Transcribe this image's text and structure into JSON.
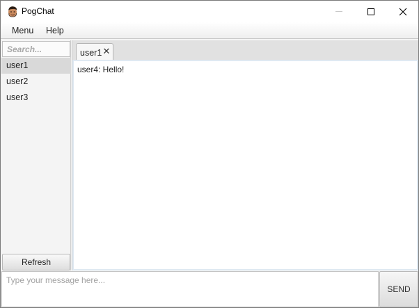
{
  "window": {
    "title": "PogChat",
    "app_icon": "avatar-face-icon",
    "controls": [
      "minimize-icon",
      "maximize-icon",
      "close-icon"
    ]
  },
  "menubar": {
    "items": [
      {
        "label": "Menu"
      },
      {
        "label": "Help"
      }
    ]
  },
  "sidebar": {
    "search_placeholder": "Search...",
    "users": [
      {
        "label": "user1",
        "selected": true
      },
      {
        "label": "user2",
        "selected": false
      },
      {
        "label": "user3",
        "selected": false
      }
    ],
    "refresh_label": "Refresh"
  },
  "tabs": [
    {
      "label": "user1",
      "close_glyph": "✕",
      "active": true
    }
  ],
  "chat": {
    "messages": [
      {
        "text": "user4: Hello!"
      }
    ]
  },
  "composer": {
    "placeholder": "Type your message here...",
    "value": "",
    "send_label": "SEND"
  }
}
